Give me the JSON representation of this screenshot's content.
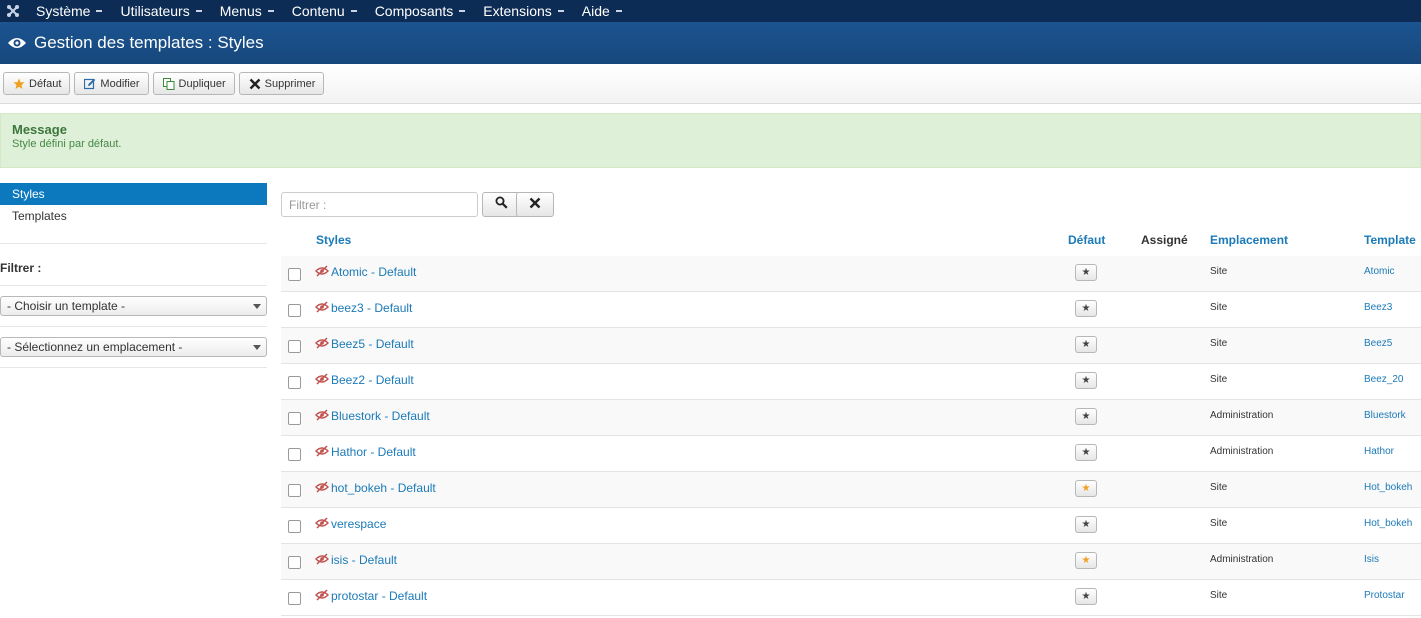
{
  "topnav": {
    "items": [
      {
        "label": "Système"
      },
      {
        "label": "Utilisateurs"
      },
      {
        "label": "Menus"
      },
      {
        "label": "Contenu"
      },
      {
        "label": "Composants"
      },
      {
        "label": "Extensions"
      },
      {
        "label": "Aide"
      }
    ]
  },
  "header": {
    "title": "Gestion des templates : Styles"
  },
  "toolbar": {
    "default_label": "Défaut",
    "edit_label": "Modifier",
    "duplicate_label": "Dupliquer",
    "delete_label": "Supprimer"
  },
  "message": {
    "title": "Message",
    "text": "Style défini par défaut."
  },
  "sidebar": {
    "links": [
      {
        "label": "Styles"
      },
      {
        "label": "Templates"
      }
    ],
    "filter_title": "Filtrer :",
    "select_template": "- Choisir un template -",
    "select_location": "- Sélectionnez un emplacement -"
  },
  "search": {
    "placeholder": "Filtrer :"
  },
  "table": {
    "headers": {
      "styles": "Styles",
      "default": "Défaut",
      "assigned": "Assigné",
      "location": "Emplacement",
      "template": "Template"
    },
    "rows": [
      {
        "name": "Atomic - Default",
        "location": "Site",
        "template": "Atomic",
        "is_default": false
      },
      {
        "name": "beez3 - Default",
        "location": "Site",
        "template": "Beez3",
        "is_default": false
      },
      {
        "name": "Beez5 - Default",
        "location": "Site",
        "template": "Beez5",
        "is_default": false
      },
      {
        "name": "Beez2 - Default",
        "location": "Site",
        "template": "Beez_20",
        "is_default": false
      },
      {
        "name": "Bluestork - Default",
        "location": "Administration",
        "template": "Bluestork",
        "is_default": false
      },
      {
        "name": "Hathor - Default",
        "location": "Administration",
        "template": "Hathor",
        "is_default": false
      },
      {
        "name": "hot_bokeh - Default",
        "location": "Site",
        "template": "Hot_bokeh",
        "is_default": true
      },
      {
        "name": "verespace",
        "location": "Site",
        "template": "Hot_bokeh",
        "is_default": false
      },
      {
        "name": "isis - Default",
        "location": "Administration",
        "template": "Isis",
        "is_default": true
      },
      {
        "name": "protostar - Default",
        "location": "Site",
        "template": "Protostar",
        "is_default": false
      }
    ]
  },
  "colors": {
    "topnav": "#0d2c55",
    "header": "#17477c",
    "link": "#1b7ab8",
    "active_sidebar": "#0c78bd",
    "message_bg": "#dff0d8",
    "default_star": "#f0a020"
  }
}
